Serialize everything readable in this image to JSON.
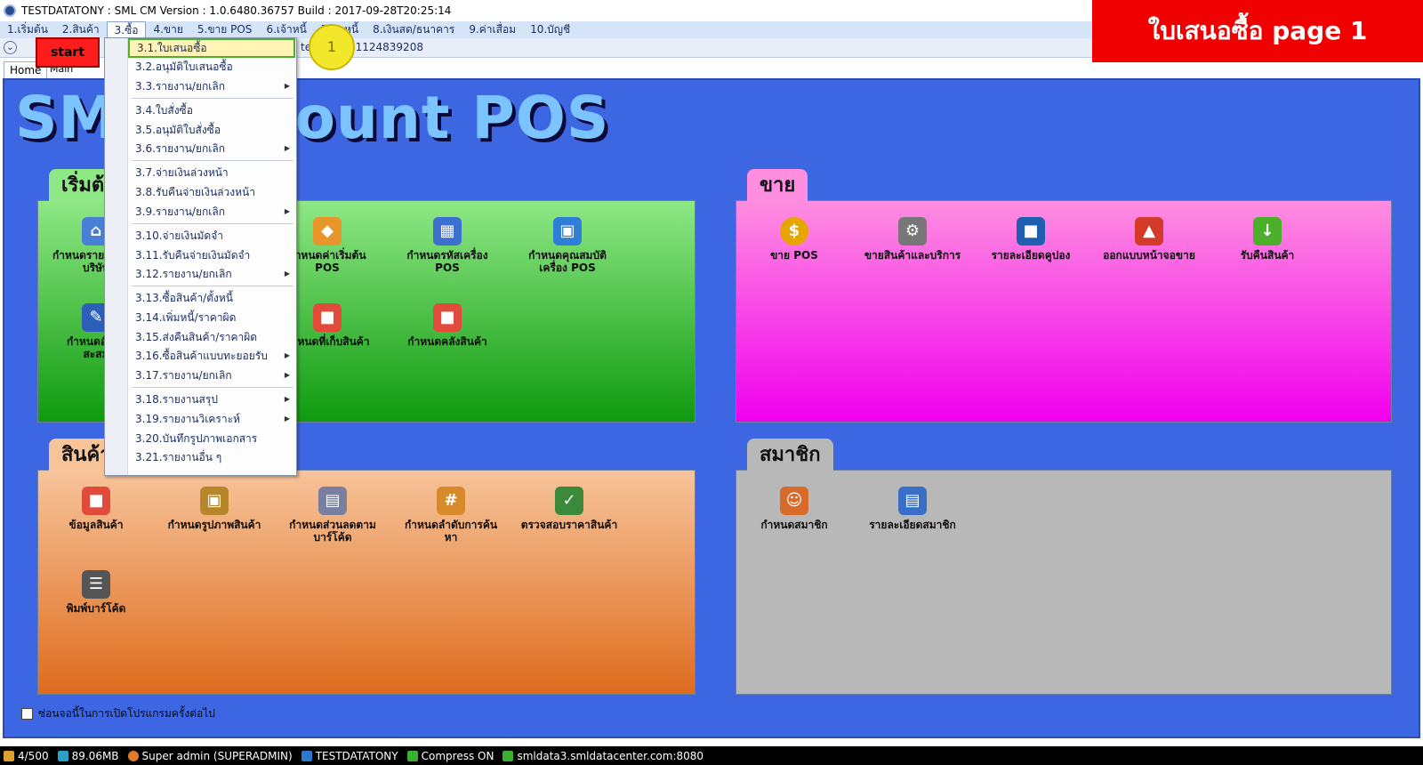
{
  "window": {
    "title": "TESTDATATONY : SML CM Version : 1.0.6480.36757  Build : 2017-09-28T20:25:14"
  },
  "menubar": {
    "items": [
      {
        "label": "1.เริ่มต้น"
      },
      {
        "label": "2.สินค้า"
      },
      {
        "label": "3.ซื้อ"
      },
      {
        "label": "4.ขาย"
      },
      {
        "label": "5.ขาย POS"
      },
      {
        "label": "6.เจ้าหนี้"
      },
      {
        "label": "7.ลูกหนี้"
      },
      {
        "label": "8.เงินสด/ธนาคาร"
      },
      {
        "label": "9.ค่าเสื่อม"
      },
      {
        "label": "10.บัญชี"
      }
    ]
  },
  "toolbar": {
    "start_label": "start",
    "identity_text": "ter Code=1124839208"
  },
  "tabs": {
    "home": "Home",
    "main": "Main"
  },
  "banner": {
    "text": "ใบเสนอซื้อ  page 1"
  },
  "callout": {
    "number": "1"
  },
  "logo": {
    "text": "SML Account POS"
  },
  "dropdown": {
    "items": [
      {
        "label": "3.1.ใบเสนอซื้อ",
        "submenu": false
      },
      {
        "label": "3.2.อนุมัติใบเสนอซื้อ",
        "submenu": false
      },
      {
        "label": "3.3.รายงาน/ยกเลิก",
        "submenu": true
      },
      {
        "label": "3.4.ใบสั่งซื้อ",
        "submenu": false
      },
      {
        "label": "3.5.อนุมัติใบสั่งซื้อ",
        "submenu": false
      },
      {
        "label": "3.6.รายงาน/ยกเลิก",
        "submenu": true
      },
      {
        "label": "3.7.จ่ายเงินล่วงหน้า",
        "submenu": false
      },
      {
        "label": "3.8.รับคืนจ่ายเงินล่วงหน้า",
        "submenu": false
      },
      {
        "label": "3.9.รายงาน/ยกเลิก",
        "submenu": true
      },
      {
        "label": "3.10.จ่ายเงินมัดจำ",
        "submenu": false
      },
      {
        "label": "3.11.รับคืนจ่ายเงินมัดจำ",
        "submenu": false
      },
      {
        "label": "3.12.รายงาน/ยกเลิก",
        "submenu": true
      },
      {
        "label": "3.13.ซื้อสินค้า/ตั้งหนี้",
        "submenu": false
      },
      {
        "label": "3.14.เพิ่มหนี้/ราคาผิด",
        "submenu": false
      },
      {
        "label": "3.15.ส่งคืนสินค้า/ราคาผิด",
        "submenu": false
      },
      {
        "label": "3.16.ซื้อสินค้าแบบทะยอยรับ",
        "submenu": true
      },
      {
        "label": "3.17.รายงาน/ยกเลิก",
        "submenu": true
      },
      {
        "label": "3.18.รายงานสรุป",
        "submenu": true
      },
      {
        "label": "3.19.รายงานวิเคราะห์",
        "submenu": true
      },
      {
        "label": "3.20.บันทึกรูปภาพเอกสาร",
        "submenu": false
      },
      {
        "label": "3.21.รายงานอื่น ๆ",
        "submenu": false
      }
    ]
  },
  "panels": {
    "start": {
      "title": "เริ่มต้น",
      "items": [
        {
          "line1": "กำหนดรายละเอียด",
          "line2": "บริษัท",
          "icon": "house-icon",
          "color": "#4a7fd6"
        },
        {
          "line1": "กำหนดค่าเริ่มต้น",
          "line2": "POS",
          "icon": "shield-icon",
          "color": "#e8952a"
        },
        {
          "line1": "กำหนดรหัสเครื่อง",
          "line2": "POS",
          "icon": "computer-icon",
          "color": "#3b6fd0"
        },
        {
          "line1": "กำหนดคุณสมบัติ",
          "line2": "เครื่อง POS",
          "icon": "device-icon",
          "color": "#2f7fd8"
        },
        {
          "line1": "กำหนดอัตรา",
          "line2": "สะสม",
          "icon": "pencil-icon",
          "color": "#2d5fb8"
        },
        {
          "line1": "กำหนดที่เก็บสินค้า",
          "line2": "",
          "icon": "boxes-icon",
          "color": "#e24a3a"
        },
        {
          "line1": "กำหนดคลังสินค้า",
          "line2": "",
          "icon": "warehouse-icon",
          "color": "#e24a3a"
        }
      ]
    },
    "sales": {
      "title": "ขาย",
      "items": [
        {
          "line1": "ขาย POS",
          "icon": "coin-icon",
          "color": "#e6a500"
        },
        {
          "line1": "ขายสินค้าและบริการ",
          "icon": "gear-icon",
          "color": "#777777"
        },
        {
          "line1": "รายละเอียดคูปอง",
          "icon": "square-icon",
          "color": "#1f5fb0"
        },
        {
          "line1": "ออกแบบหน้าจอขาย",
          "icon": "shapes-icon",
          "color": "#d43a2a"
        },
        {
          "line1": "รับคืนสินค้า",
          "icon": "download-icon",
          "color": "#4caf2a"
        }
      ]
    },
    "product": {
      "title": "สินค้า",
      "items": [
        {
          "line1": "ข้อมูลสินค้า",
          "line2": "",
          "icon": "boxes-icon",
          "color": "#e24a3a"
        },
        {
          "line1": "กำหนดรูปภาพสินค้า",
          "line2": "",
          "icon": "picture-icon",
          "color": "#b8862a"
        },
        {
          "line1": "กำหนดส่วนลดตาม",
          "line2": "บาร์โค้ด",
          "icon": "register-icon",
          "color": "#7a7fa0"
        },
        {
          "line1": "กำหนดลำดับการค้น",
          "line2": "หา",
          "icon": "tag-icon",
          "color": "#d8892a"
        },
        {
          "line1": "ตรวจสอบราคาสินค้า",
          "line2": "",
          "icon": "books-icon",
          "color": "#3a8a3a"
        },
        {
          "line1": "พิมพ์บาร์โค้ด",
          "line2": "",
          "icon": "barcode-icon",
          "color": "#555555"
        }
      ]
    },
    "member": {
      "title": "สมาชิก",
      "items": [
        {
          "line1": "กำหนดสมาชิก",
          "icon": "handshake-icon",
          "color": "#d86a2a"
        },
        {
          "line1": "รายละเอียดสมาชิก",
          "icon": "id-card-icon",
          "color": "#3a6fc8"
        }
      ]
    }
  },
  "checkbox": {
    "label": "ซ่อนจอนี้ในการเปิดโปรแกรมครั้งต่อไป"
  },
  "statusbar": {
    "count": "4/500",
    "memory": "89.06MB",
    "user": "Super admin (SUPERADMIN)",
    "db": "TESTDATATONY",
    "compress": "Compress ON",
    "server": "smldata3.smldatacenter.com:8080"
  }
}
